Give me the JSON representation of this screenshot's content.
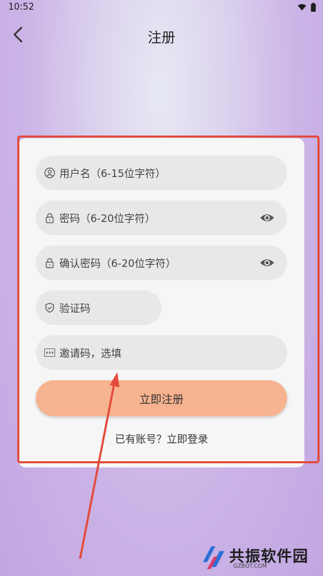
{
  "status": {
    "time": "10:52"
  },
  "header": {
    "title": "注册"
  },
  "form": {
    "username_placeholder": "用户名（6-15位字符）",
    "password_placeholder": "密码（6-20位字符）",
    "confirm_placeholder": "确认密码（6-20位字符）",
    "captcha_placeholder": "验证码",
    "invite_placeholder": "邀请码，选填",
    "submit_label": "立即注册",
    "login_prompt": "已有账号？立即登录"
  },
  "watermark": {
    "name": "共振软件园",
    "domain": "GZBQT.COM"
  },
  "icons": [
    "wifi-icon",
    "battery-icon",
    "back-arrow-icon",
    "user-icon",
    "lock-icon",
    "eye-icon",
    "shield-icon",
    "abc-icon"
  ],
  "colors": {
    "accent": "#f7b38f",
    "annotation": "#e24a3a"
  }
}
